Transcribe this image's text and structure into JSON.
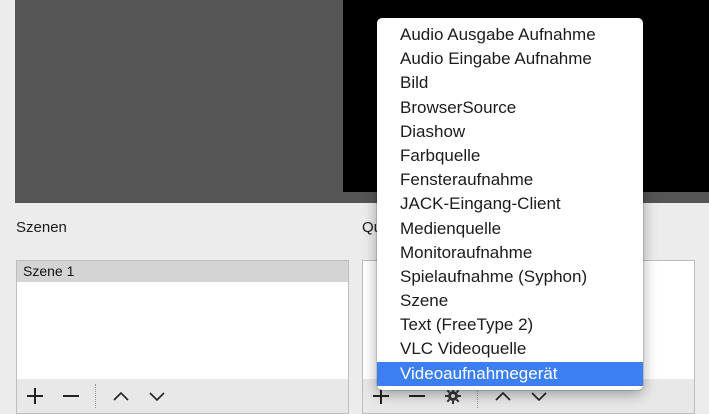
{
  "docks": {
    "scenes_title": "Szenen",
    "sources_title": "Qu"
  },
  "scenes": {
    "items": [
      "Szene 1"
    ]
  },
  "menu": {
    "items": [
      "Audio Ausgabe Aufnahme",
      "Audio Eingabe Aufnahme",
      "Bild",
      "BrowserSource",
      "Diashow",
      "Farbquelle",
      "Fensteraufnahme",
      "JACK-Eingang-Client",
      "Medienquelle",
      "Monitoraufnahme",
      "Spielaufnahme (Syphon)",
      "Szene",
      "Text (FreeType 2)",
      "VLC Videoquelle",
      "Videoaufnahmegerät"
    ],
    "selected_index": 14,
    "highlight_color": "#3b7ff2"
  },
  "icons": {
    "add": "plus-icon",
    "remove": "minus-icon",
    "up": "chevron-up-icon",
    "down": "chevron-down-icon",
    "settings": "gear-icon"
  }
}
